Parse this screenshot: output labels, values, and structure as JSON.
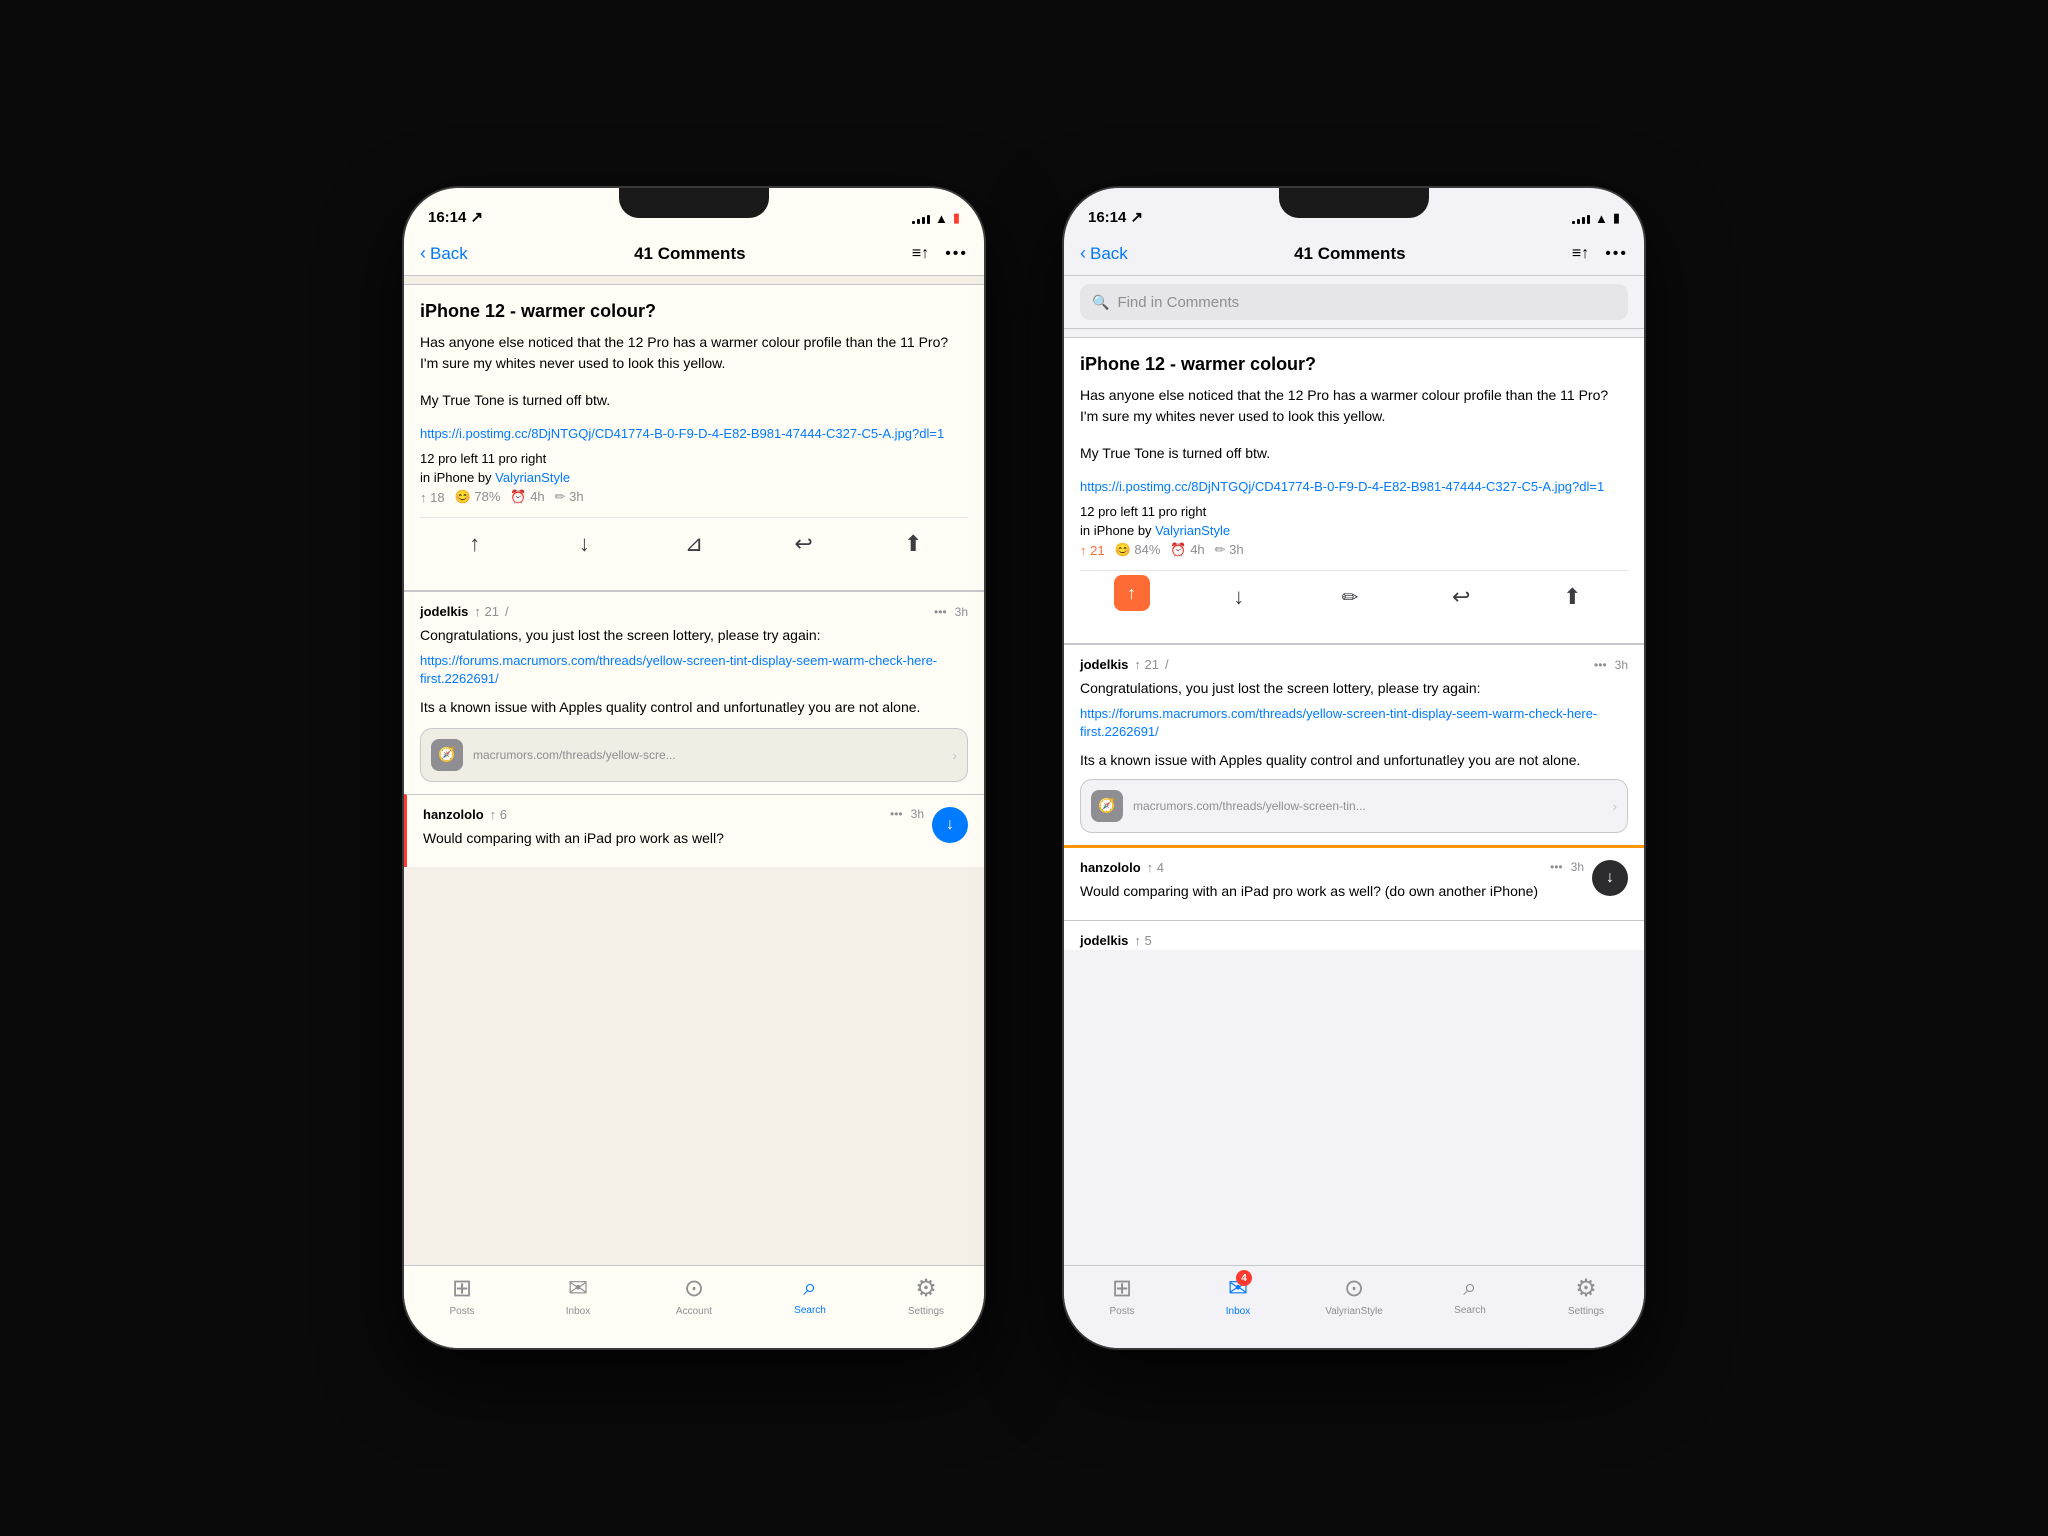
{
  "background": "#0a0a0a",
  "phones": [
    {
      "id": "left",
      "status": {
        "time": "16:14",
        "arrow": "↗",
        "signal": [
          3,
          5,
          7,
          9,
          11
        ],
        "wifi": "wifi",
        "battery": "battery_low"
      },
      "nav": {
        "back_label": "Back",
        "title": "41 Comments",
        "sort_icon": "≡↑",
        "dots": "•••"
      },
      "post": {
        "title": "iPhone 12 - warmer colour?",
        "body": "Has anyone else noticed that the 12 Pro has a warmer colour profile than the 11 Pro? I'm sure my whites never used to look this yellow.",
        "separator": "",
        "tone_note": "My True Tone is turned off btw.",
        "link": "https://i.postimg.cc/8DjNTGQj/CD41774-B-0-F9-D-4-E82-B981-47444-C327-C5-A.jpg?dl=1",
        "caption": "12 pro left 11 pro right",
        "in_label": "in iPhone by ValyrianStyle",
        "stats": "↑ 18  😊 78%  🕐 4h  ✏ 3h",
        "upvote": "↑",
        "downvote": "↓",
        "bookmark": "⊿",
        "reply": "↩",
        "share": "⬆"
      },
      "comments": [
        {
          "user": "jodelkis",
          "upvotes": "↑ 21",
          "edit": "/",
          "time": "3h",
          "dots": "•••",
          "body": "Congratulations, you just lost the screen lottery, please try again:",
          "link": "https://forums.macrumors.com/threads/yellow-screen-tint-display-seem-warm-check-here-first.2262691/",
          "link_preview_text": "macrumors.com/threads/yellow-scre...",
          "additional": "Its a known issue with Apples quality control and unfortunatley you are not alone."
        },
        {
          "user": "hanzololo",
          "upvotes": "↑ 6",
          "time": "3h",
          "dots": "•••",
          "body": "Would comparing with an iPad pro work as well?"
        }
      ],
      "tabs": [
        {
          "icon": "□",
          "label": "Posts",
          "active": false
        },
        {
          "icon": "✉",
          "label": "Inbox",
          "active": false
        },
        {
          "icon": "☻",
          "label": "Account",
          "active": false
        },
        {
          "icon": "🔍",
          "label": "Search",
          "active": true
        },
        {
          "icon": "⚙",
          "label": "Settings",
          "active": false
        }
      ]
    },
    {
      "id": "right",
      "status": {
        "time": "16:14",
        "arrow": "↗",
        "signal": [
          3,
          5,
          7,
          9,
          11
        ],
        "wifi": "wifi",
        "battery": "battery"
      },
      "nav": {
        "back_label": "Back",
        "title": "41 Comments",
        "sort_icon": "≡↑",
        "dots": "•••"
      },
      "find_bar": {
        "placeholder": "Find in Comments"
      },
      "post": {
        "title": "iPhone 12 - warmer colour?",
        "body": "Has anyone else noticed that the 12 Pro has a warmer colour profile than the 11 Pro? I'm sure my whites never used to look this yellow.",
        "tone_note": "My True Tone is turned off btw.",
        "link": "https://i.postimg.cc/8DjNTGQj/CD41774-B-0-F9-D-4-E82-B981-47444-C327-C5-A.jpg?dl=1",
        "caption": "12 pro left 11 pro right",
        "in_label": "in iPhone by",
        "author": "ValyrianStyle",
        "stats_upvote": "21",
        "stats_happy": "84%",
        "stats_clock": "4h",
        "stats_edit": "3h",
        "upvote_active": true
      },
      "comments": [
        {
          "user": "jodelkis",
          "upvotes": "↑ 21",
          "edit": "/",
          "time": "3h",
          "dots": "•••",
          "body": "Congratulations, you just lost the screen lottery, please try again:",
          "link": "https://forums.macrumors.com/threads/yellow-screen-tint-display-seem-warm-check-here-first.2262691/",
          "link_preview_text": "macrumors.com/threads/yellow-screen-tin...",
          "additional": "Its a known issue with Apples quality control and unfortunatley you are not alone."
        },
        {
          "user": "hanzololo",
          "upvotes": "↑ 4",
          "time": "3h",
          "dots": "•••",
          "body": "Would comparing with an iPad pro work as well? (do own another iPhone)"
        },
        {
          "user": "jodelkis",
          "upvotes": "↑ 5",
          "time": "",
          "dots": "",
          "body": ""
        }
      ],
      "tabs": [
        {
          "icon": "□",
          "label": "Posts",
          "active": false,
          "badge": null
        },
        {
          "icon": "✉",
          "label": "Inbox",
          "active": true,
          "badge": "4"
        },
        {
          "icon": "☻",
          "label": "ValyrianStyle",
          "active": false,
          "badge": null
        },
        {
          "icon": "🔍",
          "label": "Search",
          "active": false,
          "badge": null
        },
        {
          "icon": "⚙",
          "label": "Settings",
          "active": false,
          "badge": null
        }
      ]
    }
  ]
}
